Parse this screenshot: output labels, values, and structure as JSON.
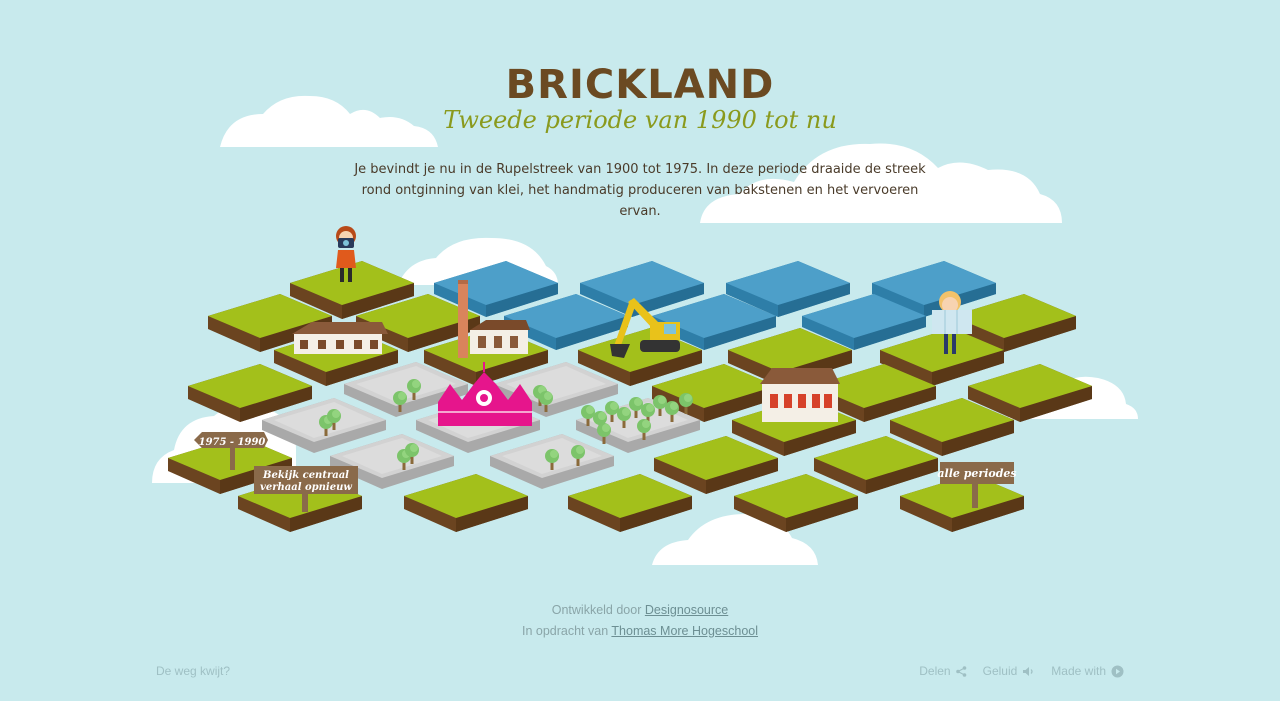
{
  "header": {
    "title": "BRICKLAND",
    "subtitle": "Tweede periode van 1990 tot nu"
  },
  "intro": {
    "line1": "Je bevindt je nu in de Rupelstreek van 1900 tot 1975. In deze periode draaide de streek",
    "line2": "rond ontginning van klei, het handmatig produceren van bakstenen en het vervoeren ervan."
  },
  "signs": {
    "previous_period": "1975 - 1990",
    "replay_line1": "Bekijk centraal",
    "replay_line2": "verhaal opnieuw",
    "all_periods": "alle periodes"
  },
  "credits": {
    "developed_by": "Ontwikkeld door",
    "developer": "Designosource",
    "commissioned_by": "In opdracht van",
    "client": "Thomas More Hogeschool"
  },
  "footer": {
    "lost": "De weg kwijt?",
    "share": "Delen",
    "sound": "Geluid",
    "made_with": "Made with"
  },
  "colors": {
    "background": "#c8eaed",
    "grass": "#a3c01b",
    "soil": "#6b4420",
    "water": "#4d9fc9",
    "concrete": "#d2d2d2",
    "title": "#6b4a22",
    "subtitle": "#8a9a1d",
    "tent": "#e6158c"
  }
}
